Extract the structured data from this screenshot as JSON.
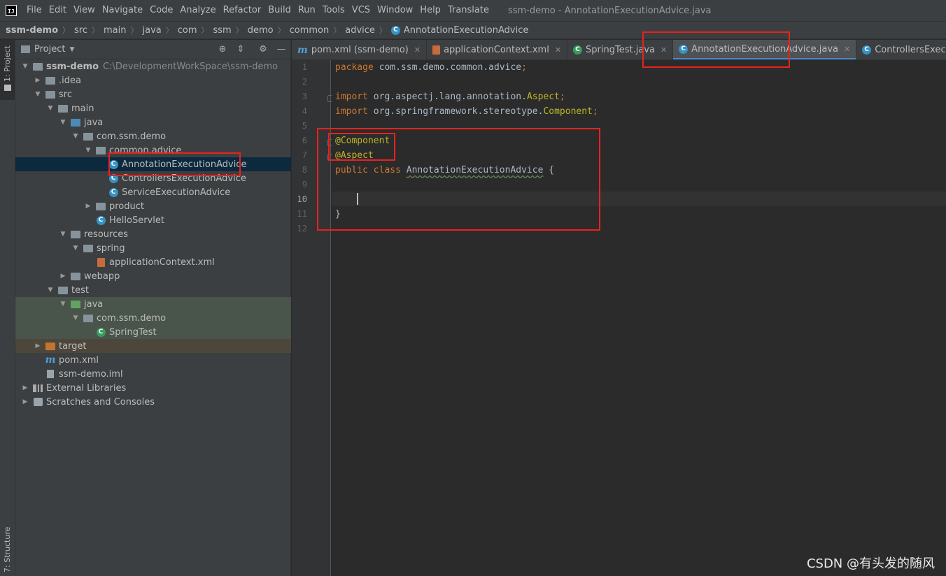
{
  "menubar": {
    "logo_label": "IJ",
    "items": [
      "File",
      "Edit",
      "View",
      "Navigate",
      "Code",
      "Analyze",
      "Refactor",
      "Build",
      "Run",
      "Tools",
      "VCS",
      "Window",
      "Help",
      "Translate"
    ],
    "window_title": "ssm-demo - AnnotationExecutionAdvice.java"
  },
  "breadcrumb": [
    "ssm-demo",
    "src",
    "main",
    "java",
    "com",
    "ssm",
    "demo",
    "common",
    "advice",
    "AnnotationExecutionAdvice"
  ],
  "left_stripe": {
    "project_label": "1: Project",
    "structure_label": "7: Structure"
  },
  "project_panel": {
    "title": "Project",
    "tree": [
      {
        "label": "ssm-demo",
        "path": "C:\\DevelopmentWorkSpace\\ssm-demo",
        "depth": 0,
        "arrow": "down",
        "icon": "folder",
        "bold": true
      },
      {
        "label": ".idea",
        "depth": 1,
        "arrow": "right",
        "icon": "folder"
      },
      {
        "label": "src",
        "depth": 1,
        "arrow": "down",
        "icon": "folder"
      },
      {
        "label": "main",
        "depth": 2,
        "arrow": "down",
        "icon": "folder"
      },
      {
        "label": "java",
        "depth": 3,
        "arrow": "down",
        "icon": "folder-source"
      },
      {
        "label": "com.ssm.demo",
        "depth": 4,
        "arrow": "down",
        "icon": "folder"
      },
      {
        "label": "common.advice",
        "depth": 5,
        "arrow": "down",
        "icon": "folder"
      },
      {
        "label": "AnnotationExecutionAdvice",
        "depth": 6,
        "arrow": "",
        "icon": "class",
        "selected": true
      },
      {
        "label": "ControllersExecutionAdvice",
        "depth": 6,
        "arrow": "",
        "icon": "class"
      },
      {
        "label": "ServiceExecutionAdvice",
        "depth": 6,
        "arrow": "",
        "icon": "class"
      },
      {
        "label": "product",
        "depth": 5,
        "arrow": "right",
        "icon": "folder"
      },
      {
        "label": "HelloServlet",
        "depth": 5,
        "arrow": "",
        "icon": "class"
      },
      {
        "label": "resources",
        "depth": 3,
        "arrow": "down",
        "icon": "folder-res"
      },
      {
        "label": "spring",
        "depth": 4,
        "arrow": "down",
        "icon": "folder"
      },
      {
        "label": "applicationContext.xml",
        "depth": 5,
        "arrow": "",
        "icon": "xml"
      },
      {
        "label": "webapp",
        "depth": 3,
        "arrow": "right",
        "icon": "folder"
      },
      {
        "label": "test",
        "depth": 2,
        "arrow": "down",
        "icon": "folder"
      },
      {
        "label": "java",
        "depth": 3,
        "arrow": "down",
        "icon": "folder-test",
        "test": true
      },
      {
        "label": "com.ssm.demo",
        "depth": 4,
        "arrow": "down",
        "icon": "folder",
        "test": true
      },
      {
        "label": "SpringTest",
        "depth": 5,
        "arrow": "",
        "icon": "class-test",
        "test": true
      },
      {
        "label": "target",
        "depth": 1,
        "arrow": "right",
        "icon": "folder-target",
        "excluded": true
      },
      {
        "label": "pom.xml",
        "depth": 1,
        "arrow": "",
        "icon": "maven"
      },
      {
        "label": "ssm-demo.iml",
        "depth": 1,
        "arrow": "",
        "icon": "iml"
      },
      {
        "label": "External Libraries",
        "depth": 0,
        "arrow": "right",
        "icon": "library"
      },
      {
        "label": "Scratches and Consoles",
        "depth": 0,
        "arrow": "right",
        "icon": "scratch"
      }
    ]
  },
  "tabs": [
    {
      "label": "pom.xml (ssm-demo)",
      "icon": "maven",
      "active": false
    },
    {
      "label": "applicationContext.xml",
      "icon": "xml",
      "active": false
    },
    {
      "label": "SpringTest.java",
      "icon": "class-test",
      "active": false
    },
    {
      "label": "AnnotationExecutionAdvice.java",
      "icon": "class",
      "active": true
    },
    {
      "label": "ControllersExecutionAdvice.java",
      "icon": "class",
      "active": false
    }
  ],
  "editor": {
    "line_numbers": [
      "1",
      "2",
      "3",
      "4",
      "5",
      "6",
      "7",
      "8",
      "9",
      "10",
      "11",
      "12"
    ],
    "current_line": "10",
    "lines": [
      [
        {
          "t": "package ",
          "c": "kw"
        },
        {
          "t": "com.ssm.demo.common.advice",
          "c": ""
        },
        {
          "t": ";",
          "c": "kw"
        }
      ],
      [],
      [
        {
          "t": "import ",
          "c": "kw"
        },
        {
          "t": "org.aspectj.lang.annotation.",
          "c": ""
        },
        {
          "t": "Aspect",
          "c": "ann"
        },
        {
          "t": ";",
          "c": "kw"
        }
      ],
      [
        {
          "t": "import ",
          "c": "kw"
        },
        {
          "t": "org.springframework.stereotype.",
          "c": ""
        },
        {
          "t": "Component",
          "c": "ann"
        },
        {
          "t": ";",
          "c": "kw"
        }
      ],
      [],
      [
        {
          "t": "@Component",
          "c": "ann"
        }
      ],
      [
        {
          "t": "@Aspect",
          "c": "ann"
        }
      ],
      [
        {
          "t": "public class ",
          "c": "kw"
        },
        {
          "t": "AnnotationExecutionAdvice",
          "c": "cname"
        },
        {
          "t": " {",
          "c": ""
        }
      ],
      [],
      [],
      [
        {
          "t": "}",
          "c": ""
        }
      ],
      []
    ]
  },
  "watermark": "CSDN @有头发的随风",
  "colors": {
    "highlight_box": "#e8221e",
    "accent": "#4a88c7"
  }
}
